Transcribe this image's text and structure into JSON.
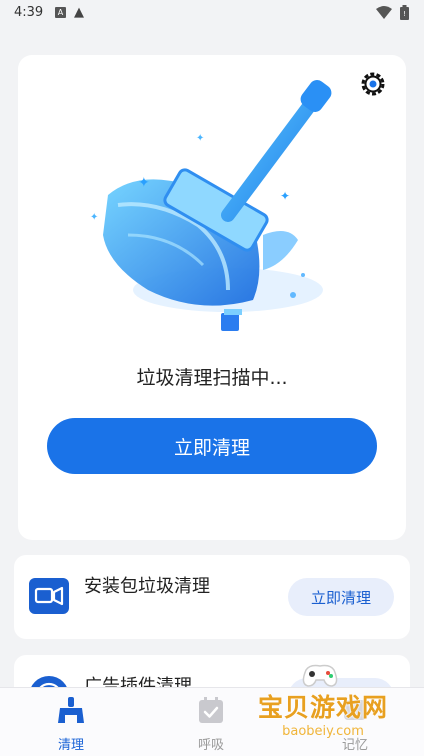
{
  "status_bar": {
    "time": "4:39",
    "notification_a": "A",
    "warning_glyph": "▲"
  },
  "hero": {
    "image_icon": "broom-illustration",
    "settings_icon": "gear-icon",
    "scan_status": "垃圾清理扫描中...",
    "clean_button_label": "立即清理"
  },
  "features": [
    {
      "title": "安装包垃圾清理",
      "button_label": "立即清理",
      "icon": "apk-package-icon"
    },
    {
      "title": "广告插件清理",
      "button_label": "立即清理",
      "icon": "ad-plugin-icon"
    }
  ],
  "bottom_nav": {
    "items": [
      {
        "label": "清理",
        "icon": "broom-icon",
        "active": true
      },
      {
        "label": "呼吸",
        "icon": "calendar-check-icon",
        "active": false
      },
      {
        "label": "记忆",
        "icon": "memory-icon",
        "active": false
      }
    ]
  },
  "watermark": {
    "title": "宝贝游戏网",
    "url": "baobeiy.com"
  },
  "colors": {
    "accent": "#1a73e8",
    "background": "#f2f3f5",
    "secondary_button_bg": "#e8eefb",
    "watermark": "#e8a020"
  }
}
